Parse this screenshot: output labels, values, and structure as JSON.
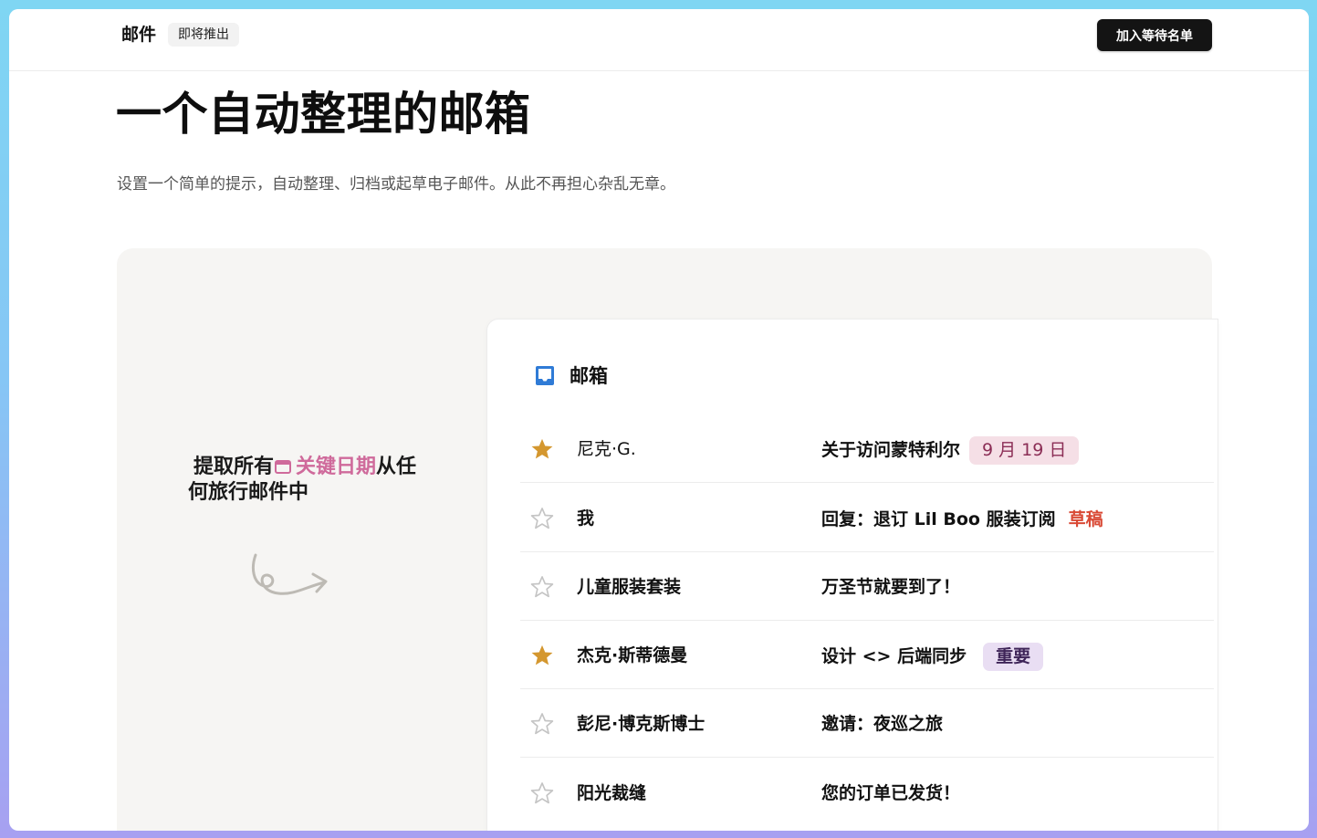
{
  "header": {
    "brand": "邮件",
    "badge": "即将推出",
    "cta_label": "加入等待名单"
  },
  "hero": {
    "title": "一个自动整理的邮箱",
    "subtitle": "设置一个简单的提示，自动整理、归档或起草电子邮件。从此不再担心杂乱无章。"
  },
  "feature": {
    "prefix": "提取所有",
    "highlight": "关键日期",
    "suffix_line1": "从任",
    "line2": "何旅行邮件中",
    "highlight_icon": "calendar-icon",
    "highlight_color": "#cf6a9b"
  },
  "inbox": {
    "title": "邮箱",
    "icon": "inbox-tray-icon",
    "accent": "#2f7bd6",
    "emails": [
      {
        "sender": "尼克·G.",
        "subject": "关于访问蒙特利尔",
        "tag": "9 月 19 日",
        "tag_type": "date",
        "starred": true
      },
      {
        "sender": "我",
        "subject": "回复：退订 Lil Boo 服装订阅",
        "tag": "草稿",
        "tag_type": "draft",
        "starred": false
      },
      {
        "sender": "儿童服装套装",
        "subject": "万圣节就要到了！",
        "tag": "",
        "tag_type": "",
        "starred": false
      },
      {
        "sender": "杰克·斯蒂德曼",
        "subject": "设计 <> 后端同步",
        "tag": "重要",
        "tag_type": "important",
        "starred": true
      },
      {
        "sender": "彭尼·博克斯博士",
        "subject": "邀请：夜巡之旅",
        "tag": "",
        "tag_type": "",
        "starred": false
      },
      {
        "sender": "阳光裁缝",
        "subject": "您的订单已发货！",
        "tag": "",
        "tag_type": "",
        "starred": false
      }
    ]
  },
  "colors": {
    "star_filled": "#d4972f",
    "star_empty": "#c4c4c4"
  }
}
